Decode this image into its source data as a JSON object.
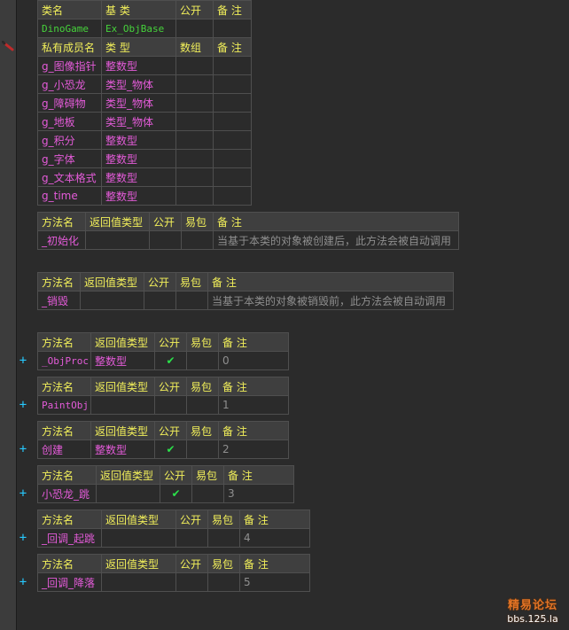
{
  "class_header": {
    "col_name": "类名",
    "col_base": "基 类",
    "col_public": "公开",
    "col_remark": "备 注",
    "name": "DinoGame",
    "base": "Ex_ObjBase"
  },
  "members_header": {
    "col_name": "私有成员名",
    "col_type": "类 型",
    "col_array": "数组",
    "col_remark": "备 注"
  },
  "members": [
    {
      "name": "g_图像指针",
      "type": "整数型"
    },
    {
      "name": "g_小恐龙",
      "type": "类型_物体"
    },
    {
      "name": "g_障碍物",
      "type": "类型_物体"
    },
    {
      "name": "g_地板",
      "type": "类型_物体"
    },
    {
      "name": "g_积分",
      "type": "整数型"
    },
    {
      "name": "g_字体",
      "type": "整数型"
    },
    {
      "name": "g_文本格式",
      "type": "整数型"
    },
    {
      "name": "g_time",
      "type": "整数型"
    }
  ],
  "method_header": {
    "col_name": "方法名",
    "col_return": "返回值类型",
    "col_public": "公开",
    "col_easy": "易包",
    "col_remark": "备 注"
  },
  "methods": [
    {
      "name": "_初始化",
      "return_type": "",
      "public": false,
      "remark": "当基于本类的对象被创建后，此方法会被自动调用"
    },
    {
      "name": "_销毁",
      "return_type": "",
      "public": false,
      "remark": "当基于本类的对象被销毁前，此方法会被自动调用"
    },
    {
      "name": "_ObjProc",
      "return_type": "整数型",
      "public": true,
      "remark": "0"
    },
    {
      "name": "PaintObj",
      "return_type": "",
      "public": false,
      "remark": "1"
    },
    {
      "name": "创建",
      "return_type": "整数型",
      "public": true,
      "remark": "2"
    },
    {
      "name": "小恐龙_跳",
      "return_type": "",
      "public": true,
      "remark": "3"
    },
    {
      "name": "_回调_起跳",
      "return_type": "",
      "public": false,
      "remark": "4"
    },
    {
      "name": "_回调_降落",
      "return_type": "",
      "public": false,
      "remark": "5"
    }
  ],
  "expand_symbol": "+",
  "checkmark": "✔",
  "colors": {
    "background": "#2b2b2b",
    "header_text": "#f2ef5a",
    "class_text": "#46d33b",
    "name_text": "#e45bd9",
    "remark_text": "#8f8f8f",
    "check": "#2be14a",
    "expand": "#27c9ff"
  },
  "watermark": {
    "line1": "精易论坛",
    "line2": "bbs.125.la"
  }
}
